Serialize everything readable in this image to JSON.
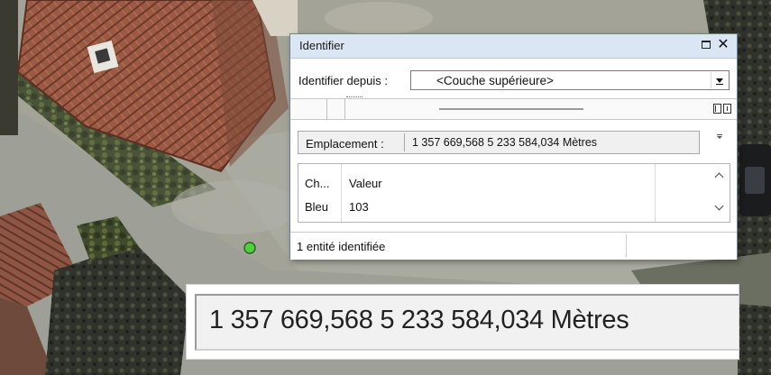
{
  "window": {
    "title": "Identifier",
    "close_glyph": "✕"
  },
  "identify_from": {
    "label": "Identifier depuis :",
    "value": "<Couche supérieure>"
  },
  "location": {
    "label": "Emplacement :",
    "value": "1 357 669,568  5 233 584,034 Mètres"
  },
  "attributes": {
    "columns": [
      "Ch...",
      "Valeur"
    ],
    "rows": [
      {
        "field": "Bleu",
        "value": "103"
      }
    ]
  },
  "status": {
    "text": "1 entité identifiée"
  },
  "zoom": {
    "text": "1 357 669,568  5 233 584,034 Mètres"
  },
  "colors": {
    "titlebar": "#dbe6f4",
    "point_marker": "#4cd23a"
  },
  "icons": [
    "maximize-icon",
    "close-icon",
    "dropdown-arrow-icon",
    "expand-all-icon",
    "collapse-all-icon",
    "location-options-icon",
    "scroll-up-icon",
    "scroll-down-icon",
    "map-point-marker"
  ]
}
